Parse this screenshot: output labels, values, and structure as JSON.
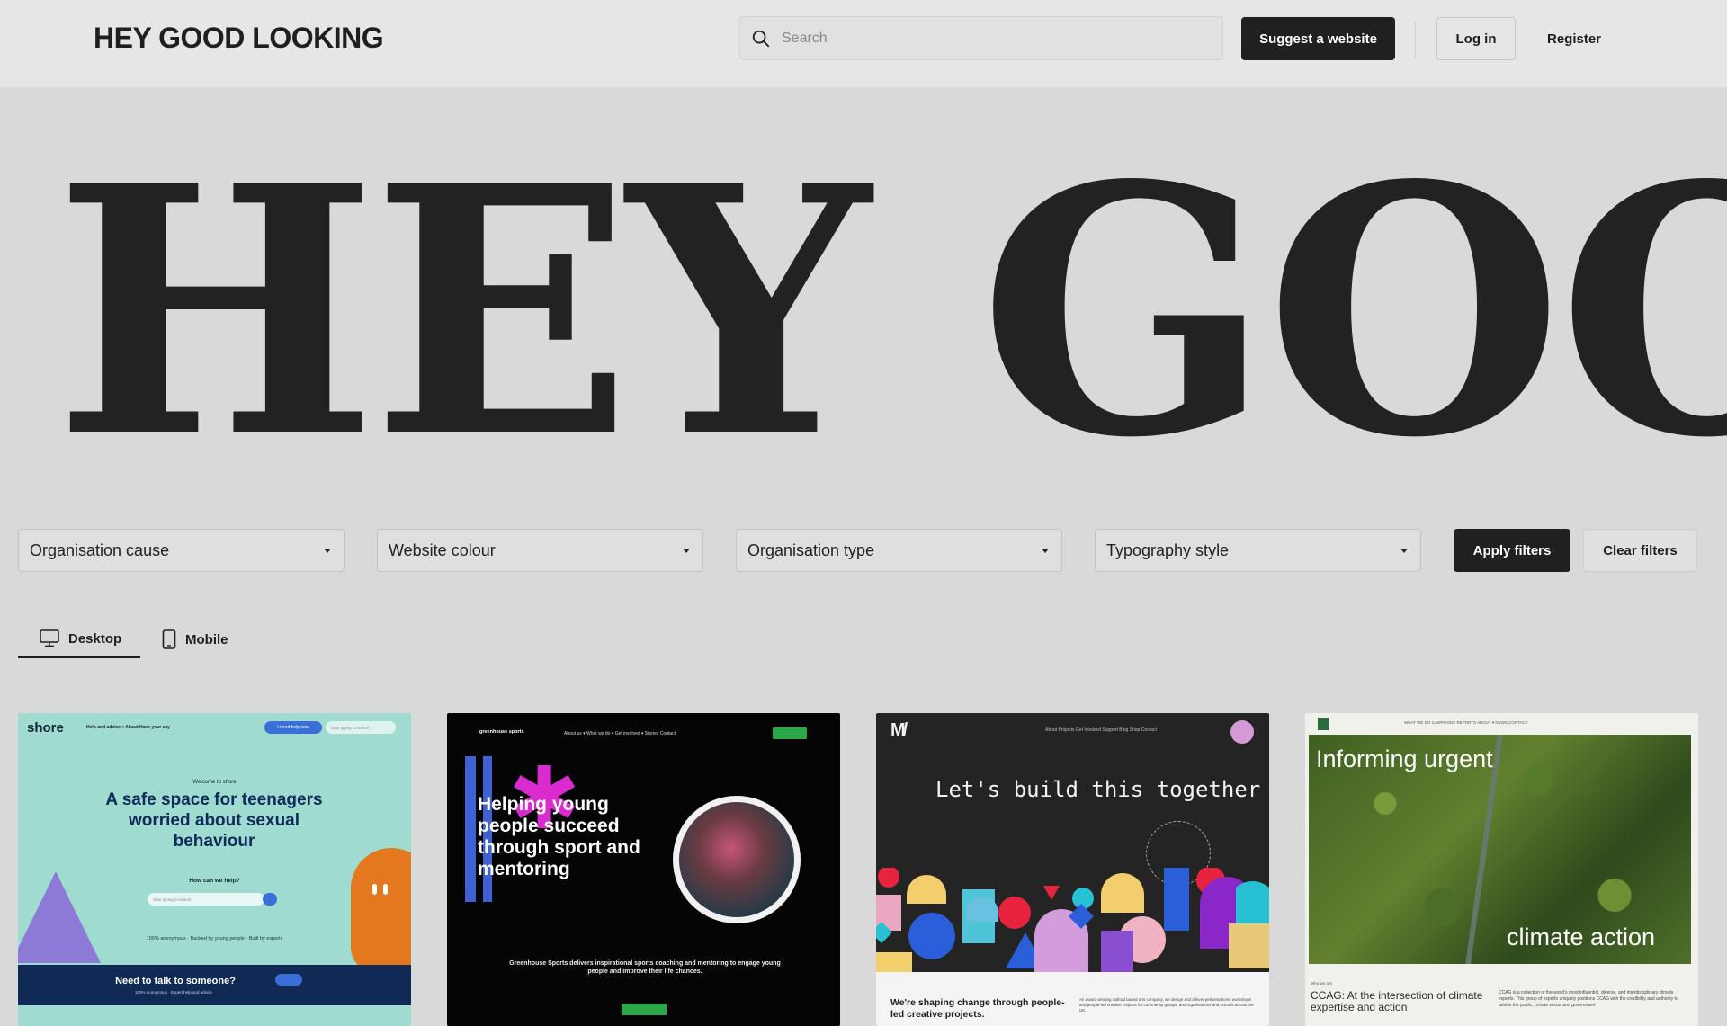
{
  "header": {
    "logo": "HEY GOOD LOOKING",
    "search_placeholder": "Search",
    "suggest_label": "Suggest a website",
    "login_label": "Log in",
    "register_label": "Register"
  },
  "hero": {
    "text": "HEY GOOD LOOKING"
  },
  "filters": {
    "selects": [
      "Organisation cause",
      "Website colour",
      "Organisation type",
      "Typography style"
    ],
    "apply_label": "Apply filters",
    "clear_label": "Clear filters"
  },
  "tabs": [
    {
      "label": "Desktop",
      "icon": "desktop-icon",
      "active": true
    },
    {
      "label": "Mobile",
      "icon": "mobile-icon",
      "active": false
    }
  ],
  "cards": [
    {
      "brand": "shore",
      "nav": "Help and advice ▾   About   Have your say",
      "nav_button": "I need help now",
      "nav_search": "Start typing to search",
      "welcome": "Welcome to shore",
      "headline": "A safe space for teenagers worried about sexual behaviour",
      "help_question": "How can we help?",
      "help_input": "Start typing to search",
      "trust": "100% anonymous  ·  Backed by young people  ·  Built by experts",
      "footer_title": "Need to talk to someone?",
      "footer_sub": "100% anonymous · Expert help and advice"
    },
    {
      "logo": "greenhouse sports",
      "nav": "About us ▾    What we do ▾    Get involved ▾    Stories    Contact",
      "headline": "Helping young people succeed through sport and mentoring",
      "body": "Greenhouse Sports delivers inspirational sports coaching and mentoring to engage young people and improve their life chances."
    },
    {
      "mark": "M/",
      "nav": "About    Projects    Get Involved    Support    Blog    Shop    Contact",
      "headline": "Let's build this together",
      "band_title": "We're shaping change through people-led creative projects.",
      "band_text": "An award winning Salford based arts company, we design and deliver performances, workshops and people-led creative projects for community groups, arts organisations and schools across the UK."
    },
    {
      "nav": "WHAT WE DO    CAMPAIGNS    REPORTS    ABOUT ▾    NEWS    CONTACT",
      "h1": "Informing urgent",
      "h2": "climate action",
      "small": "Who we are",
      "sub_title": "CCAG: At the intersection of climate expertise and action",
      "sub_text": "CCAG is a collection of the world's most influential, diverse, and interdisciplinary climate experts. This group of experts uniquely positions CCAG with the credibility and authority to advise the public, private sector and government"
    }
  ],
  "colors": {
    "accent_dark": "#202020",
    "background": "#d9d9d9",
    "header_bg": "#e6e6e6"
  }
}
